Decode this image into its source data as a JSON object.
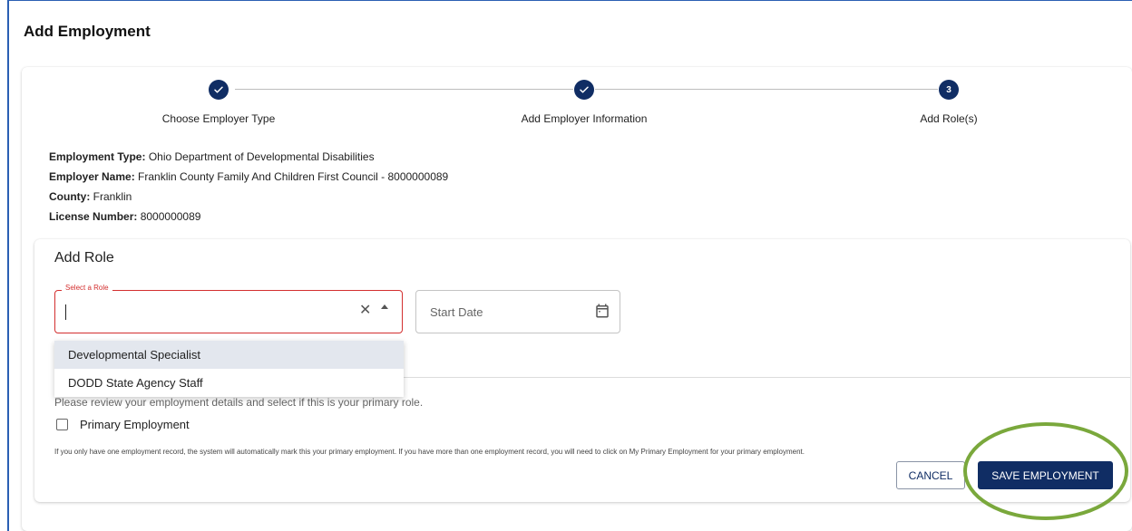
{
  "page": {
    "title": "Add Employment"
  },
  "stepper": {
    "steps": [
      {
        "label": "Choose Employer Type",
        "status": "complete"
      },
      {
        "label": "Add Employer Information",
        "status": "complete"
      },
      {
        "label": "Add Role(s)",
        "status": "active",
        "number": "3"
      }
    ]
  },
  "summary": {
    "employment_type_label": "Employment Type:",
    "employment_type_value": "Ohio Department of Developmental Disabilities",
    "employer_name_label": "Employer Name:",
    "employer_name_value": "Franklin County Family And Children First Council - 8000000089",
    "county_label": "County:",
    "county_value": "Franklin",
    "license_label": "License Number:",
    "license_value": "8000000089"
  },
  "add_role": {
    "title": "Add Role",
    "role_select": {
      "label": "Select a Role",
      "value": ""
    },
    "start_date": {
      "placeholder": "Start Date"
    },
    "options": [
      "Developmental Specialist",
      "DODD State Agency Staff"
    ],
    "hint": "Please review your employment details and select if this is your primary role.",
    "primary_checkbox_label": "Primary Employment",
    "note": "If you only have one employment record, the system will automatically mark this your primary employment. If you have more than one employment record, you will need to click on My Primary Employment for your primary employment."
  },
  "buttons": {
    "cancel": "CANCEL",
    "save": "SAVE EMPLOYMENT"
  },
  "colors": {
    "primary": "#102d64",
    "error": "#d32f2f",
    "highlight": "#7aa83c"
  }
}
